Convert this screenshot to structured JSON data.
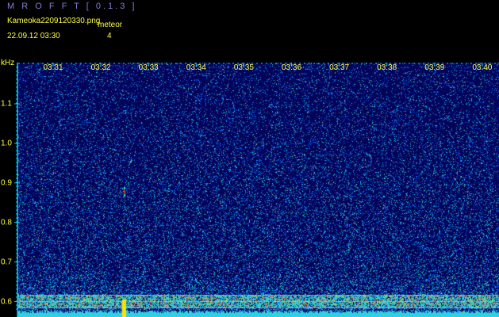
{
  "header": {
    "app_title": "M R O F F T  [ 0.1.3 ]",
    "file_name": "Kameoka2209120330.png",
    "datetime": "22.09.12 03:30",
    "event_label": "meteor",
    "event_count": "4"
  },
  "spectrogram": {
    "frequency_unit": "kHz",
    "frequency_labels": [
      "1.1",
      "1.0",
      "0.9",
      "0.8",
      "0.7",
      "0.6"
    ],
    "time_labels": [
      "03:31",
      "03:32",
      "03:33",
      "03:34",
      "03:35",
      "03:36",
      "03:37",
      "03:38",
      "03:39",
      "03:40"
    ],
    "colors": {
      "background": "#040448",
      "label_text": "#ffff40",
      "title_text": "#7f7fd8",
      "axis_line": "#00c8ff",
      "noise_floor": "#30d0e0",
      "marker": "#ffe000"
    }
  }
}
